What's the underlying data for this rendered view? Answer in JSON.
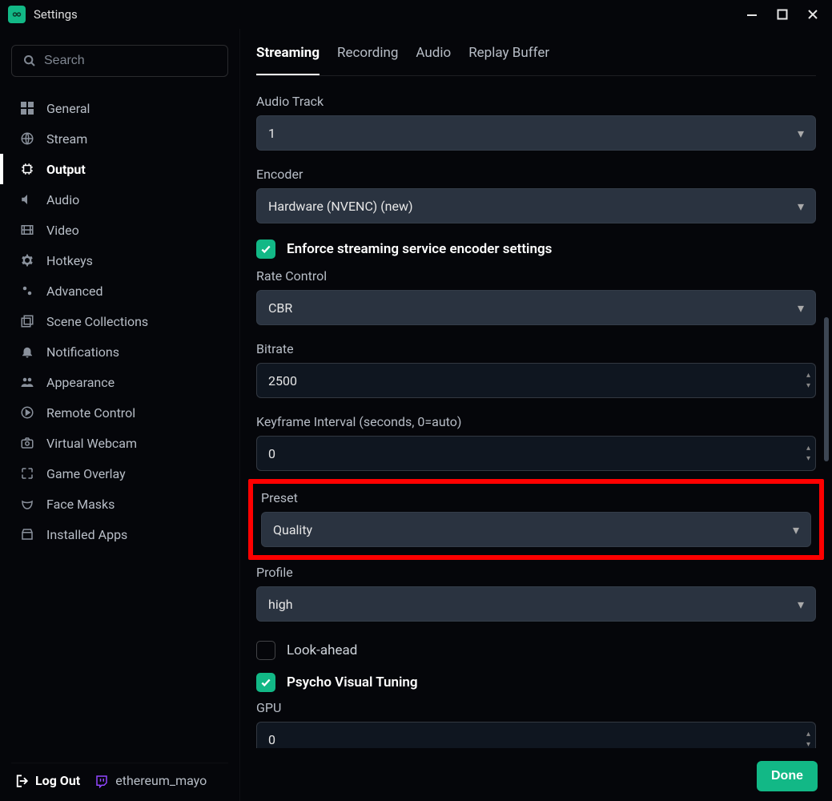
{
  "window": {
    "title": "Settings"
  },
  "search": {
    "placeholder": "Search"
  },
  "sidebar": {
    "items": [
      {
        "label": "General",
        "icon": "grid-icon"
      },
      {
        "label": "Stream",
        "icon": "globe-icon"
      },
      {
        "label": "Output",
        "icon": "chip-icon",
        "active": true
      },
      {
        "label": "Audio",
        "icon": "volume-icon"
      },
      {
        "label": "Video",
        "icon": "film-icon"
      },
      {
        "label": "Hotkeys",
        "icon": "gear-icon"
      },
      {
        "label": "Advanced",
        "icon": "gears-icon"
      },
      {
        "label": "Scene Collections",
        "icon": "collections-icon"
      },
      {
        "label": "Notifications",
        "icon": "bell-icon"
      },
      {
        "label": "Appearance",
        "icon": "people-icon"
      },
      {
        "label": "Remote Control",
        "icon": "play-circle-icon"
      },
      {
        "label": "Virtual Webcam",
        "icon": "camera-icon"
      },
      {
        "label": "Game Overlay",
        "icon": "expand-icon"
      },
      {
        "label": "Face Masks",
        "icon": "mask-icon"
      },
      {
        "label": "Installed Apps",
        "icon": "store-icon"
      }
    ],
    "logout_label": "Log Out",
    "username": "ethereum_mayo"
  },
  "tabs": [
    {
      "label": "Streaming",
      "active": true
    },
    {
      "label": "Recording"
    },
    {
      "label": "Audio"
    },
    {
      "label": "Replay Buffer"
    }
  ],
  "form": {
    "audio_track": {
      "label": "Audio Track",
      "value": "1"
    },
    "encoder": {
      "label": "Encoder",
      "value": "Hardware (NVENC) (new)"
    },
    "enforce": {
      "label": "Enforce streaming service encoder settings",
      "checked": true
    },
    "rate_control": {
      "label": "Rate Control",
      "value": "CBR"
    },
    "bitrate": {
      "label": "Bitrate",
      "value": "2500"
    },
    "keyframe": {
      "label": "Keyframe Interval (seconds, 0=auto)",
      "value": "0"
    },
    "preset": {
      "label": "Preset",
      "value": "Quality"
    },
    "profile": {
      "label": "Profile",
      "value": "high"
    },
    "look_ahead": {
      "label": "Look-ahead",
      "checked": false
    },
    "psycho": {
      "label": "Psycho Visual Tuning",
      "checked": true
    },
    "gpu": {
      "label": "GPU",
      "value": "0"
    }
  },
  "footer": {
    "done": "Done"
  },
  "colors": {
    "accent": "#12b886"
  }
}
